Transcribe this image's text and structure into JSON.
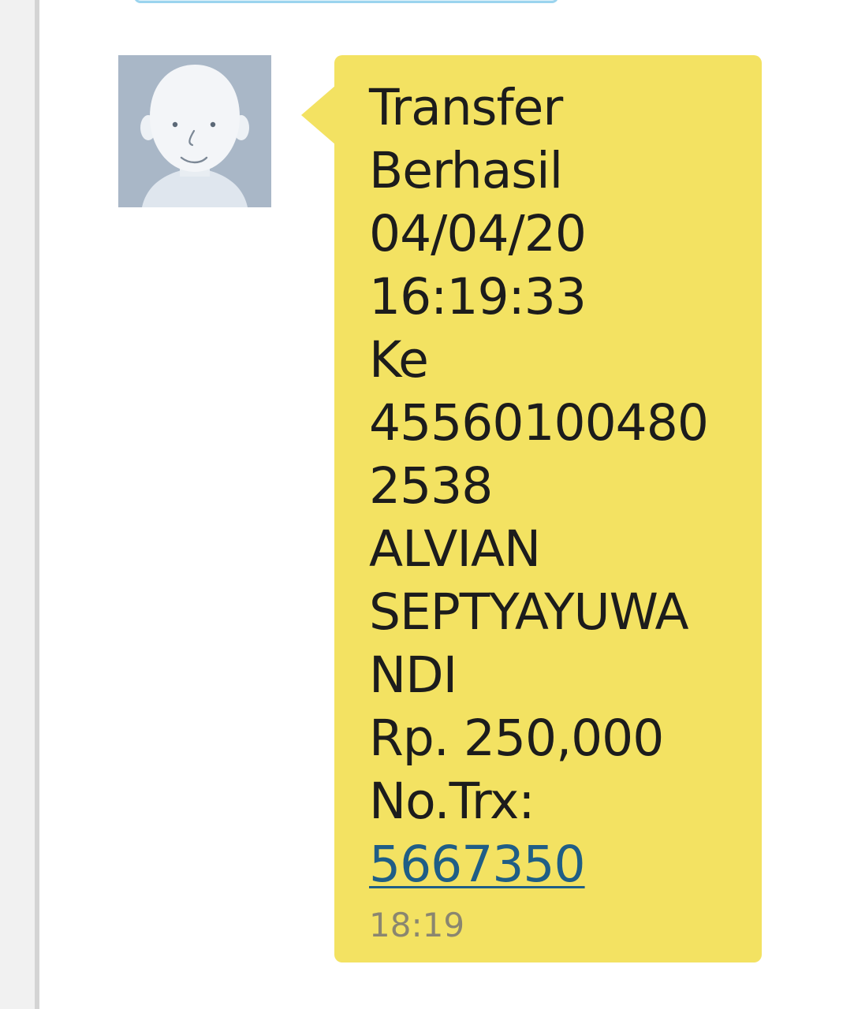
{
  "message": {
    "lines": [
      "Transfer",
      "Berhasil",
      "04/04/20",
      "16:19:33",
      "Ke",
      "45560100480",
      "2538",
      "ALVIAN",
      "SEPTYAYUWA",
      "NDI",
      "Rp. 250,000",
      "No.Trx:"
    ],
    "trx_link": "5667350",
    "time": "18:19"
  },
  "colors": {
    "bubble": "#f3e262",
    "link": "#1f5e86",
    "avatar_bg": "#a9b7c7"
  },
  "icons": {
    "avatar": "default-contact-avatar-icon"
  }
}
